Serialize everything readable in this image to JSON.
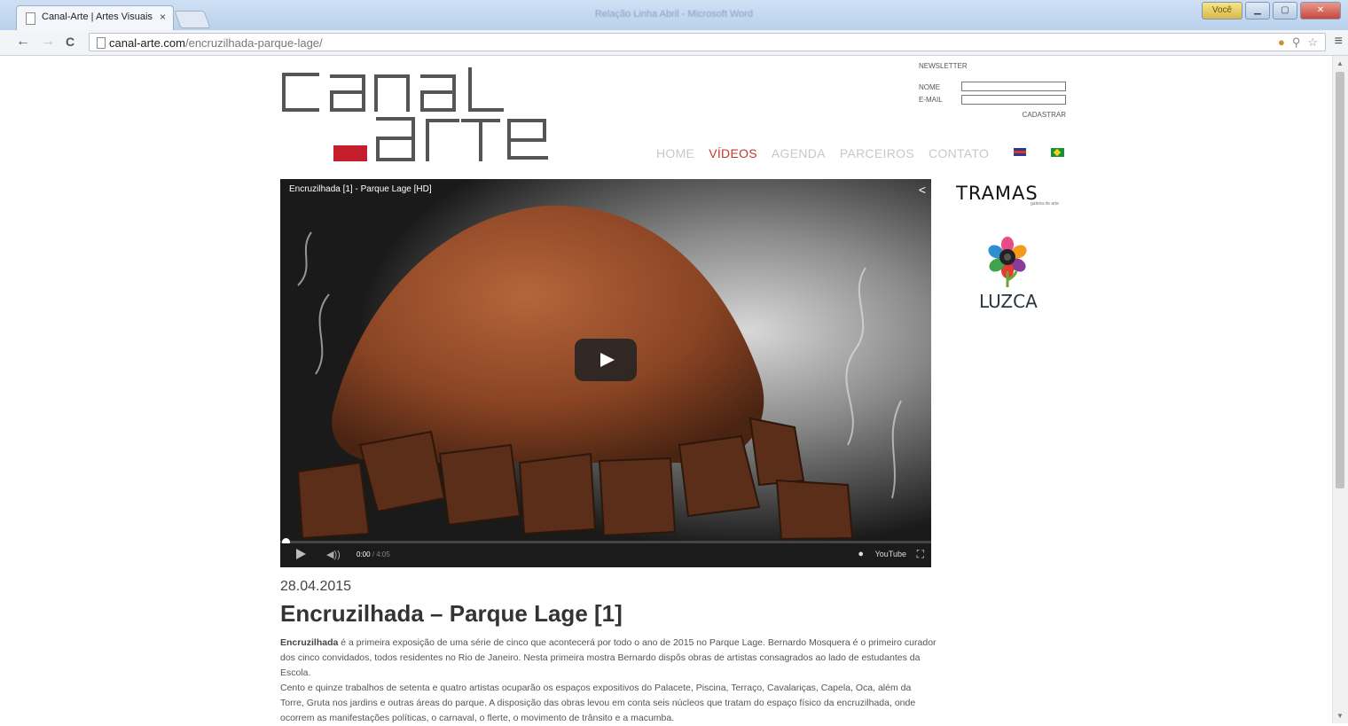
{
  "browser": {
    "tab_title": "Canal-Arte | Artes Visuais",
    "tab_close": "×",
    "window_title": "Relação Linha Abril - Microsoft Word",
    "user_button": "Você",
    "url_domain": "canal-arte.com",
    "url_path": "/encruzilhada-parque-lage/",
    "back_glyph": "←",
    "forward_glyph": "→",
    "reload_glyph": "C",
    "menu_glyph": "≡"
  },
  "newsletter": {
    "title": "NEWSLETTER",
    "name_label": "NOME",
    "email_label": "E-MAIL",
    "submit_label": "CADASTRAR"
  },
  "nav": {
    "items": [
      "HOME",
      "VÍDEOS",
      "AGENDA",
      "PARCEIROS",
      "CONTATO"
    ],
    "active_index": 1
  },
  "video": {
    "title": "Encruzilhada [1] - Parque Lage [HD]",
    "current_time": "0:00",
    "duration": "/ 4:05",
    "yt_label": "YouTube"
  },
  "sponsors": {
    "tramas": "TRAMAS",
    "tramas_sub": "galeria de arte",
    "luzca": "LUZCA"
  },
  "post": {
    "date": "28.04.2015",
    "title": "Encruzilhada – Parque Lage [1]",
    "lead_bold": "Encruzilhada",
    "lead_rest": " é a primeira exposição de uma série de cinco que acontecerá por todo o ano de 2015 no Parque Lage. Bernardo Mosquera é o primeiro curador dos cinco convidados, todos residentes no Rio de Janeiro. Nesta primeira mostra Bernardo dispôs obras de artistas consagrados ao lado de estudantes da Escola.",
    "paragraph2": "Cento e quinze trabalhos de setenta e quatro artistas ocuparão os espaços expositivos do Palacete, Piscina, Terraço, Cavalariças, Capela, Oca, além da Torre, Gruta nos jardins e outras áreas do parque. A disposição das obras levou em conta seis núcleos que tratam do espaço físico da encruzilhada, onde ocorrem as manifestações políticas, o carnaval, o flerte, o movimento de trânsito e a macumba."
  },
  "colors": {
    "accent": "#c0392b",
    "nav_inactive": "#c8c8c8",
    "logo_grey": "#555555"
  }
}
